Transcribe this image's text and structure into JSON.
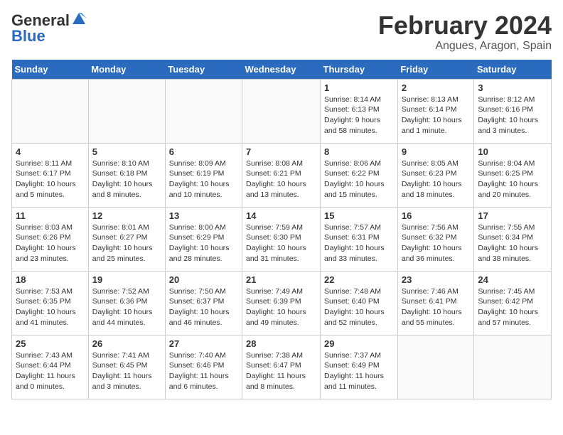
{
  "header": {
    "logo_general": "General",
    "logo_blue": "Blue",
    "month": "February 2024",
    "location": "Angues, Aragon, Spain"
  },
  "days_of_week": [
    "Sunday",
    "Monday",
    "Tuesday",
    "Wednesday",
    "Thursday",
    "Friday",
    "Saturday"
  ],
  "weeks": [
    [
      {
        "day": "",
        "info": ""
      },
      {
        "day": "",
        "info": ""
      },
      {
        "day": "",
        "info": ""
      },
      {
        "day": "",
        "info": ""
      },
      {
        "day": "1",
        "info": "Sunrise: 8:14 AM\nSunset: 6:13 PM\nDaylight: 9 hours\nand 58 minutes."
      },
      {
        "day": "2",
        "info": "Sunrise: 8:13 AM\nSunset: 6:14 PM\nDaylight: 10 hours\nand 1 minute."
      },
      {
        "day": "3",
        "info": "Sunrise: 8:12 AM\nSunset: 6:16 PM\nDaylight: 10 hours\nand 3 minutes."
      }
    ],
    [
      {
        "day": "4",
        "info": "Sunrise: 8:11 AM\nSunset: 6:17 PM\nDaylight: 10 hours\nand 5 minutes."
      },
      {
        "day": "5",
        "info": "Sunrise: 8:10 AM\nSunset: 6:18 PM\nDaylight: 10 hours\nand 8 minutes."
      },
      {
        "day": "6",
        "info": "Sunrise: 8:09 AM\nSunset: 6:19 PM\nDaylight: 10 hours\nand 10 minutes."
      },
      {
        "day": "7",
        "info": "Sunrise: 8:08 AM\nSunset: 6:21 PM\nDaylight: 10 hours\nand 13 minutes."
      },
      {
        "day": "8",
        "info": "Sunrise: 8:06 AM\nSunset: 6:22 PM\nDaylight: 10 hours\nand 15 minutes."
      },
      {
        "day": "9",
        "info": "Sunrise: 8:05 AM\nSunset: 6:23 PM\nDaylight: 10 hours\nand 18 minutes."
      },
      {
        "day": "10",
        "info": "Sunrise: 8:04 AM\nSunset: 6:25 PM\nDaylight: 10 hours\nand 20 minutes."
      }
    ],
    [
      {
        "day": "11",
        "info": "Sunrise: 8:03 AM\nSunset: 6:26 PM\nDaylight: 10 hours\nand 23 minutes."
      },
      {
        "day": "12",
        "info": "Sunrise: 8:01 AM\nSunset: 6:27 PM\nDaylight: 10 hours\nand 25 minutes."
      },
      {
        "day": "13",
        "info": "Sunrise: 8:00 AM\nSunset: 6:29 PM\nDaylight: 10 hours\nand 28 minutes."
      },
      {
        "day": "14",
        "info": "Sunrise: 7:59 AM\nSunset: 6:30 PM\nDaylight: 10 hours\nand 31 minutes."
      },
      {
        "day": "15",
        "info": "Sunrise: 7:57 AM\nSunset: 6:31 PM\nDaylight: 10 hours\nand 33 minutes."
      },
      {
        "day": "16",
        "info": "Sunrise: 7:56 AM\nSunset: 6:32 PM\nDaylight: 10 hours\nand 36 minutes."
      },
      {
        "day": "17",
        "info": "Sunrise: 7:55 AM\nSunset: 6:34 PM\nDaylight: 10 hours\nand 38 minutes."
      }
    ],
    [
      {
        "day": "18",
        "info": "Sunrise: 7:53 AM\nSunset: 6:35 PM\nDaylight: 10 hours\nand 41 minutes."
      },
      {
        "day": "19",
        "info": "Sunrise: 7:52 AM\nSunset: 6:36 PM\nDaylight: 10 hours\nand 44 minutes."
      },
      {
        "day": "20",
        "info": "Sunrise: 7:50 AM\nSunset: 6:37 PM\nDaylight: 10 hours\nand 46 minutes."
      },
      {
        "day": "21",
        "info": "Sunrise: 7:49 AM\nSunset: 6:39 PM\nDaylight: 10 hours\nand 49 minutes."
      },
      {
        "day": "22",
        "info": "Sunrise: 7:48 AM\nSunset: 6:40 PM\nDaylight: 10 hours\nand 52 minutes."
      },
      {
        "day": "23",
        "info": "Sunrise: 7:46 AM\nSunset: 6:41 PM\nDaylight: 10 hours\nand 55 minutes."
      },
      {
        "day": "24",
        "info": "Sunrise: 7:45 AM\nSunset: 6:42 PM\nDaylight: 10 hours\nand 57 minutes."
      }
    ],
    [
      {
        "day": "25",
        "info": "Sunrise: 7:43 AM\nSunset: 6:44 PM\nDaylight: 11 hours\nand 0 minutes."
      },
      {
        "day": "26",
        "info": "Sunrise: 7:41 AM\nSunset: 6:45 PM\nDaylight: 11 hours\nand 3 minutes."
      },
      {
        "day": "27",
        "info": "Sunrise: 7:40 AM\nSunset: 6:46 PM\nDaylight: 11 hours\nand 6 minutes."
      },
      {
        "day": "28",
        "info": "Sunrise: 7:38 AM\nSunset: 6:47 PM\nDaylight: 11 hours\nand 8 minutes."
      },
      {
        "day": "29",
        "info": "Sunrise: 7:37 AM\nSunset: 6:49 PM\nDaylight: 11 hours\nand 11 minutes."
      },
      {
        "day": "",
        "info": ""
      },
      {
        "day": "",
        "info": ""
      }
    ]
  ]
}
